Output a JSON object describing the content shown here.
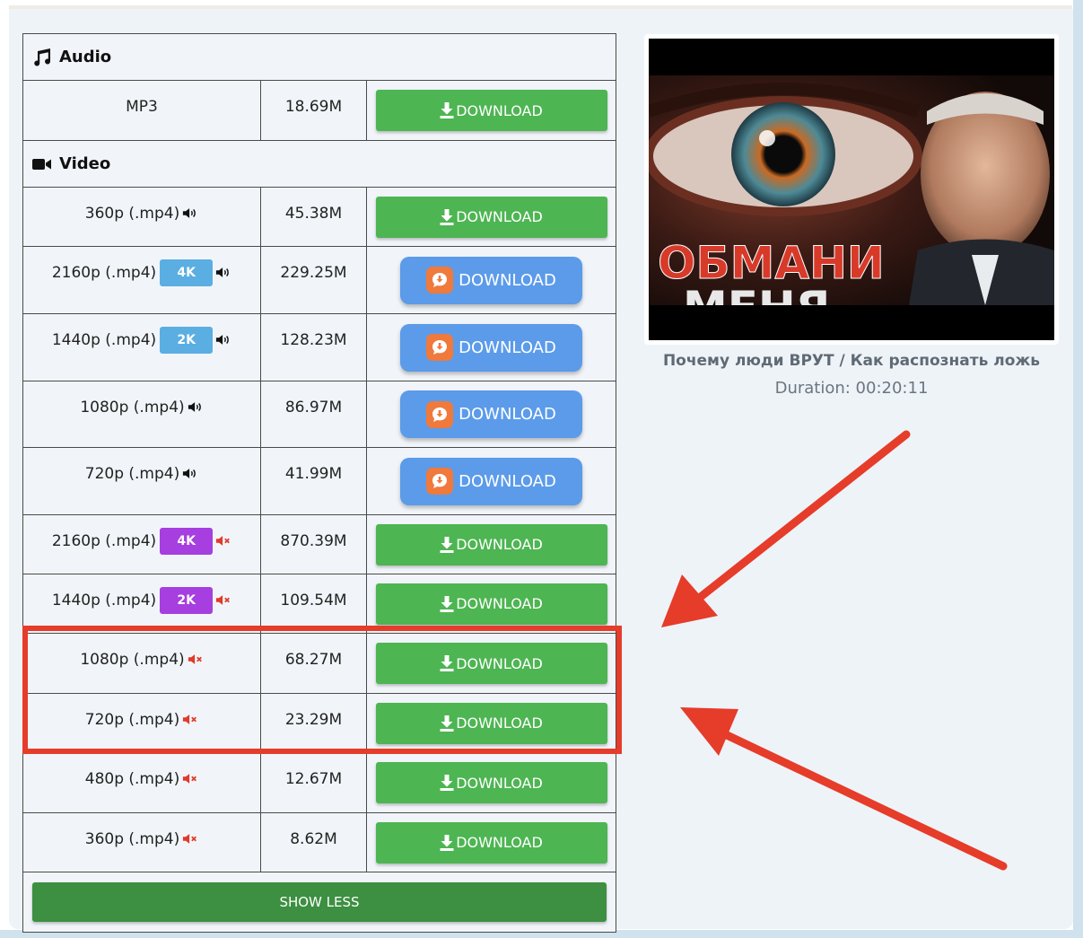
{
  "audio_section": {
    "label": "Audio"
  },
  "video_section": {
    "label": "Video"
  },
  "download_label": "DOWNLOAD",
  "rows": {
    "mp3": {
      "format": "MP3",
      "size": "18.69M"
    },
    "v360a": {
      "format": "360p (.mp4)",
      "size": "45.38M"
    },
    "v2160a": {
      "format": "2160p (.mp4)",
      "badge": "4K",
      "size": "229.25M"
    },
    "v1440a": {
      "format": "1440p (.mp4)",
      "badge": "2K",
      "size": "128.23M"
    },
    "v1080a": {
      "format": "1080p (.mp4)",
      "size": "86.97M"
    },
    "v720a": {
      "format": "720p (.mp4)",
      "size": "41.99M"
    },
    "v2160m": {
      "format": "2160p (.mp4)",
      "badge": "4K",
      "size": "870.39M"
    },
    "v1440m": {
      "format": "1440p (.mp4)",
      "badge": "2K",
      "size": "109.54M"
    },
    "v1080m": {
      "format": "1080p (.mp4)",
      "size": "68.27M"
    },
    "v720m": {
      "format": "720p (.mp4)",
      "size": "23.29M"
    },
    "v480m": {
      "format": "480p (.mp4)",
      "size": "12.67M"
    },
    "v360m": {
      "format": "360p (.mp4)",
      "size": "8.62M"
    }
  },
  "show_less_label": "SHOW LESS",
  "video": {
    "thumbnail_text_line1": "ОБМАНИ",
    "thumbnail_text_line2": "МЕНЯ",
    "title": "Почему люди ВРУТ / Как распознать ложь",
    "duration": "Duration: 00:20:11"
  },
  "colors": {
    "green_button": "#4db552",
    "blue_button": "#5b9bea",
    "show_less_button": "#3d8f41",
    "badge_blue": "#5aaee2",
    "badge_purple": "#a63ee0",
    "annotation_red": "#e63c2a"
  },
  "icons": {
    "audio": "music-note-icon",
    "video": "video-camera-icon",
    "sound_on": "speaker-on-icon",
    "sound_off": "speaker-muted-icon",
    "download": "download-arrow-icon",
    "app": "app-chat-icon"
  }
}
